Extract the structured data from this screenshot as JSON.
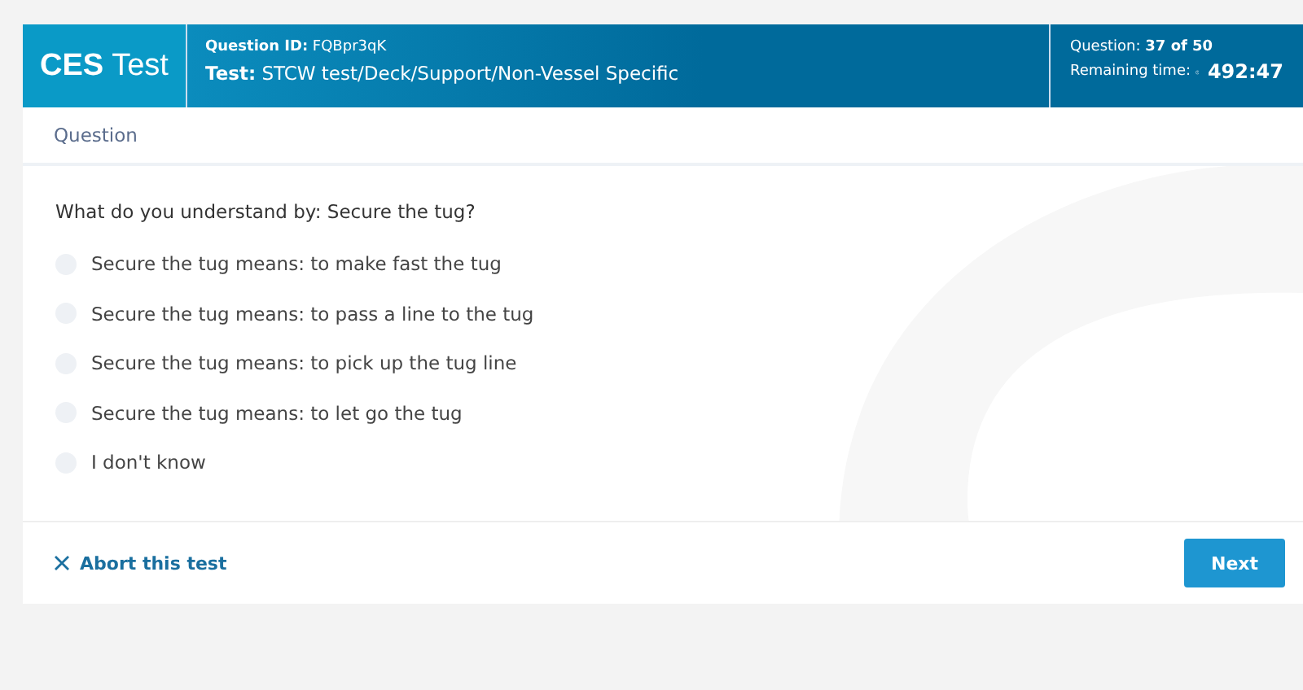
{
  "brand": {
    "bold": "CES",
    "light": "Test"
  },
  "header": {
    "question_id_label": "Question ID:",
    "question_id": "FQBpr3qK",
    "test_label": "Test:",
    "test": "STCW test/Deck/Support/Non-Vessel Specific",
    "progress_label": "Question:",
    "progress": "37 of 50",
    "time_label": "Remaining time:",
    "time": "492:47"
  },
  "section_title": "Question",
  "question": "What do you understand by: Secure the tug?",
  "options": [
    {
      "label": "Secure the tug means: to make fast the tug",
      "selected": false
    },
    {
      "label": "Secure the tug means: to pass a line to the tug",
      "selected": false
    },
    {
      "label": "Secure the tug means: to pick up the tug line",
      "selected": false
    },
    {
      "label": "Secure the tug means: to let go the tug",
      "selected": false
    },
    {
      "label": "I don't know",
      "selected": false
    }
  ],
  "abort_link": "Abort this test",
  "next_button": "Next"
}
